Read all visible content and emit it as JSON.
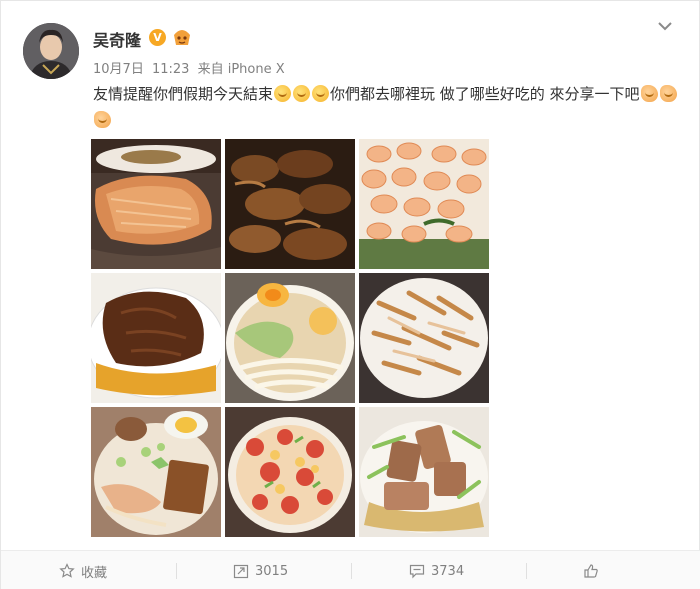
{
  "post": {
    "author": {
      "name": "吴奇隆",
      "verified_badge": "V"
    },
    "meta": {
      "date": "10月7日",
      "time": "11:23",
      "source_prefix": "来自",
      "source": "iPhone X"
    },
    "text": {
      "part1": "友情提醒你們假期今天結束",
      "part2": "你們都去哪裡玩 做了哪些好吃的 來分享一下吧"
    },
    "photos": [
      {
        "name": "salmon-steak",
        "icon": "food-photo"
      },
      {
        "name": "braised-chicken-wings",
        "icon": "food-photo"
      },
      {
        "name": "shrimp-dish",
        "icon": "food-photo"
      },
      {
        "name": "braised-pork",
        "icon": "food-photo"
      },
      {
        "name": "udon-noodle-soup",
        "icon": "food-photo"
      },
      {
        "name": "stir-fried-noodles",
        "icon": "food-photo"
      },
      {
        "name": "noodle-soup-egg",
        "icon": "food-photo"
      },
      {
        "name": "tomato-egg-rice",
        "icon": "food-photo"
      },
      {
        "name": "sliced-meat-vegetables",
        "icon": "food-photo"
      }
    ]
  },
  "actions": {
    "favorite_label": "收藏",
    "repost_count": "3015",
    "comment_count": "3734"
  },
  "colors": {
    "text": "#333333",
    "meta": "#808080",
    "verified": "#f7a824"
  }
}
